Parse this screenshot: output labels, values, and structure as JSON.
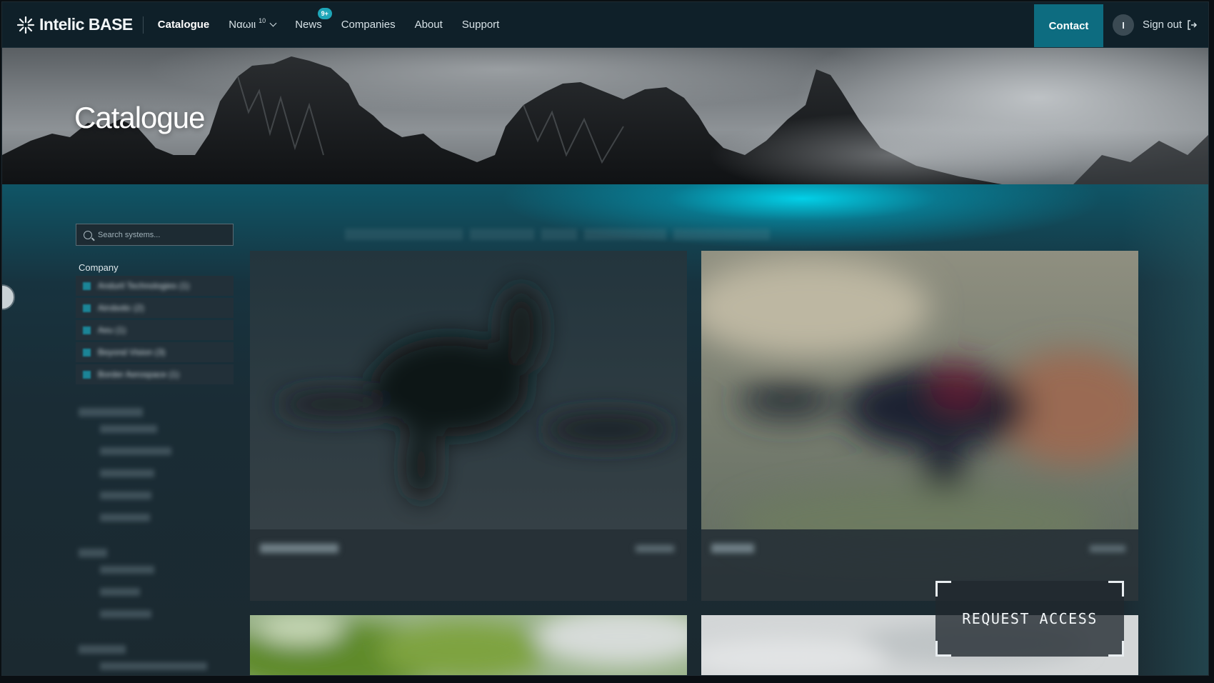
{
  "brand": {
    "name": "Intelic BASE",
    "logo_icon": "snowflake-burst-icon"
  },
  "nav": {
    "items": [
      {
        "label": "Catalogue",
        "active": true
      },
      {
        "label": "Nαωιι",
        "sup": "10",
        "dropdown": true
      },
      {
        "label": "News",
        "badge": "9+"
      },
      {
        "label": "Companies"
      },
      {
        "label": "About"
      },
      {
        "label": "Support"
      }
    ],
    "contact_label": "Contact",
    "avatar_initial": "I",
    "signout_label": "Sign out",
    "signout_icon": "sign-out-icon"
  },
  "hero": {
    "title": "Catalogue"
  },
  "search": {
    "placeholder": "Search systems..."
  },
  "filters": {
    "company_title": "Company",
    "company_items": [
      "Anduril Technologies (1)",
      "Airobotic (2)",
      "Aeu (1)",
      "Beyond Vision (3)",
      "Border Aerospace (1)"
    ]
  },
  "actions": {
    "request_access": "REQUEST ACCESS"
  },
  "colors": {
    "nav_bg": "#0f2029",
    "accent": "#0d6c80",
    "badge": "#1ea6b8",
    "glow": "#00e6ff"
  }
}
